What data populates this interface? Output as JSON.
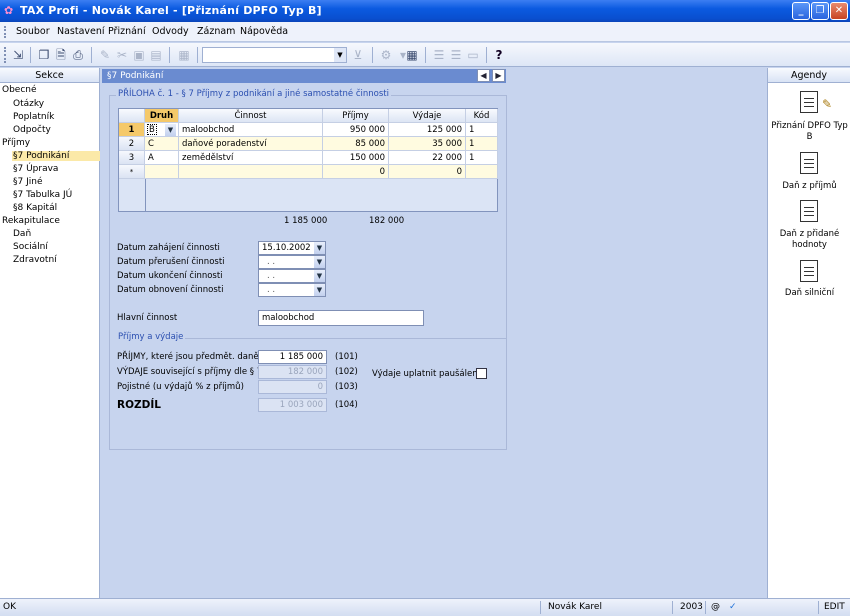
{
  "window": {
    "title": "TAX Profi - Novák Karel - [Přiznání DPFO Typ B]"
  },
  "menu": [
    "Soubor",
    "Nastavení",
    "Přiznání",
    "Odvody",
    "Záznam",
    "Nápověda"
  ],
  "left_pane": {
    "header": "Sekce",
    "items": [
      {
        "label": "Obecné",
        "level": 1
      },
      {
        "label": "Otázky",
        "level": 2
      },
      {
        "label": "Poplatník",
        "level": 2
      },
      {
        "label": "Odpočty",
        "level": 2
      },
      {
        "label": "Příjmy",
        "level": 1
      },
      {
        "label": "§7 Podnikání",
        "level": 2,
        "selected": true
      },
      {
        "label": "§7 Úprava",
        "level": 2
      },
      {
        "label": "§7 Jiné",
        "level": 2
      },
      {
        "label": "§7 Tabulka JÚ",
        "level": 2
      },
      {
        "label": "§8 Kapitál",
        "level": 2
      },
      {
        "label": "Rekapitulace",
        "level": 1
      },
      {
        "label": "Daň",
        "level": 2
      },
      {
        "label": "Sociální",
        "level": 2
      },
      {
        "label": "Zdravotní",
        "level": 2
      }
    ]
  },
  "main": {
    "header": "§7 Podnikání",
    "section_title": "PŘÍLOHA č. 1 - § 7 Příjmy z podnikání a jiné samostatné činnosti",
    "grid": {
      "columns": [
        "Druh",
        "Činnost",
        "Příjmy",
        "Výdaje",
        "Kód"
      ],
      "rows": [
        {
          "num": "1",
          "druh": "B",
          "cinnost": "maloobchod",
          "prijmy": "950 000",
          "vydaje": "125 000",
          "kod": "1"
        },
        {
          "num": "2",
          "druh": "C",
          "cinnost": "daňové poradenství",
          "prijmy": "85 000",
          "vydaje": "35 000",
          "kod": "1"
        },
        {
          "num": "3",
          "druh": "A",
          "cinnost": "zemědělství",
          "prijmy": "150 000",
          "vydaje": "22 000",
          "kod": "1"
        },
        {
          "num": "*",
          "druh": "",
          "cinnost": "",
          "prijmy": "0",
          "vydaje": "0",
          "kod": ""
        }
      ],
      "total_prijmy": "1 185 000",
      "total_vydaje": "182 000"
    },
    "dates": {
      "zahajeni_label": "Datum zahájení činnosti",
      "zahajeni_value": "15.10.2002",
      "preruseni_label": "Datum přerušení činnosti",
      "preruseni_value": ". .",
      "ukonceni_label": "Datum ukončení činnosti",
      "ukonceni_value": ". .",
      "obnoveni_label": "Datum obnovení činnosti",
      "obnoveni_value": ". ."
    },
    "hlavni_label": "Hlavní činnost",
    "hlavni_value": "maloobchod",
    "prijmy_vydaje": {
      "title": "Příjmy a výdaje",
      "prijmy_label": "PŘÍJMY, které jsou předmět. daně",
      "prijmy_value": "1 185 000",
      "prijmy_code": "(101)",
      "vydaje_label": "VÝDAJE související s příjmy dle § 7",
      "vydaje_value": "182 000",
      "vydaje_code": "(102)",
      "pojistne_label": "Pojistné (u výdajů % z příjmů)",
      "pojistne_value": "0",
      "pojistne_code": "(103)",
      "rozdil_label": "ROZDÍL",
      "rozdil_value": "1 003 000",
      "rozdil_code": "(104)",
      "pausal_label": "Výdaje uplatnit paušálem"
    }
  },
  "right_pane": {
    "header": "Agendy",
    "items": [
      "Přiznání DPFO Typ B",
      "Daň z příjmů",
      "Daň z přidané hodnoty",
      "Daň silniční"
    ]
  },
  "status": {
    "left": "OK",
    "user": "Novák Karel",
    "year": "2003",
    "mode": "EDIT"
  },
  "colors": {
    "title_bar": "#0b5ae0",
    "selection": "#fbe9a8",
    "panel": "#c7d4ee",
    "section_title": "#2b4fb0"
  }
}
